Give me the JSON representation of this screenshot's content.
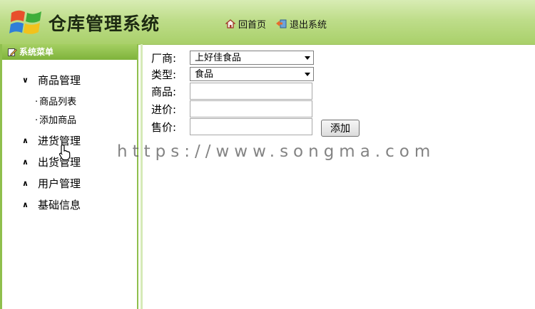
{
  "header": {
    "title": "仓库管理系统",
    "home_label": "回首页",
    "logout_label": "退出系统"
  },
  "sidebar": {
    "title": "系统菜单",
    "sections": [
      {
        "label": "商品管理",
        "expanded": true,
        "items": [
          {
            "label": "商品列表"
          },
          {
            "label": "添加商品"
          }
        ]
      },
      {
        "label": "进货管理",
        "expanded": false
      },
      {
        "label": "出货管理",
        "expanded": false
      },
      {
        "label": "用户管理",
        "expanded": false
      },
      {
        "label": "基础信息",
        "expanded": false
      }
    ]
  },
  "form": {
    "manufacturer_label": "厂商:",
    "manufacturer_value": "上好佳食品",
    "type_label": "类型:",
    "type_value": "食品",
    "product_label": "商品:",
    "product_value": "",
    "cost_label": "进价:",
    "cost_value": "",
    "price_label": "售价:",
    "price_value": "",
    "submit_label": "添加"
  },
  "watermark": "https://www.songma.com",
  "colors": {
    "header_green": "#a9d06a",
    "sidebar_border": "#8fbf4d",
    "sidebar_head": "#7fb33b"
  }
}
